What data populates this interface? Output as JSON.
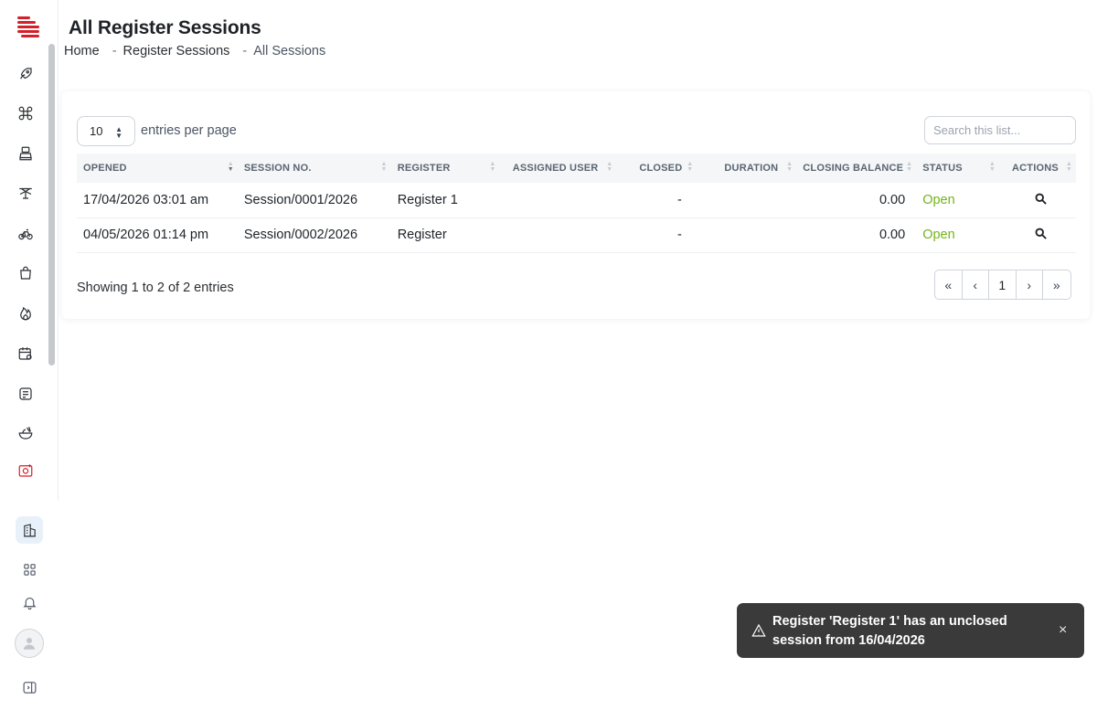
{
  "header": {
    "title": "All Register Sessions",
    "breadcrumb": [
      "Home",
      "Register Sessions",
      "All Sessions"
    ],
    "separator": "-"
  },
  "sidebar": {
    "icons": [
      "rocket-icon",
      "command-icon",
      "cash-register-icon",
      "hanger-icon",
      "bicycle-icon",
      "bag-icon",
      "flame-icon",
      "calendar-settings-icon",
      "receipt-icon",
      "food-bowl-icon",
      "camera-plus-icon",
      "building-icon",
      "apps-grid-icon",
      "bell-icon",
      "user-avatar-icon",
      "sidebar-toggle-icon"
    ],
    "active_color": "#d3202a"
  },
  "controls": {
    "entries_value": "10",
    "entries_label": "entries per page",
    "search_placeholder": "Search this list..."
  },
  "table": {
    "columns": [
      "OPENED",
      "SESSION NO.",
      "REGISTER",
      "ASSIGNED USER",
      "CLOSED",
      "DURATION",
      "CLOSING BALANCE",
      "STATUS",
      "ACTIONS"
    ],
    "rows": [
      {
        "opened": "17/04/2026 03:01 am",
        "session_no": "Session/0001/2026",
        "register": "Register 1",
        "assigned_user": "",
        "closed": "-",
        "duration": "",
        "closing_balance": "0.00",
        "status": "Open"
      },
      {
        "opened": "04/05/2026 01:14 pm",
        "session_no": "Session/0002/2026",
        "register": "Register",
        "assigned_user": "",
        "closed": "-",
        "duration": "",
        "closing_balance": "0.00",
        "status": "Open"
      }
    ]
  },
  "footer": {
    "info": "Showing 1 to 2 of 2 entries",
    "pager": [
      "«",
      "‹",
      "1",
      "›",
      "»"
    ]
  },
  "toast": {
    "message": "Register 'Register 1' has an unclosed session from 16/04/2026",
    "close": "×"
  },
  "colors": {
    "brand": "#d3202a",
    "status_open": "#73b51b",
    "toast_bg": "#3a3a3a"
  }
}
